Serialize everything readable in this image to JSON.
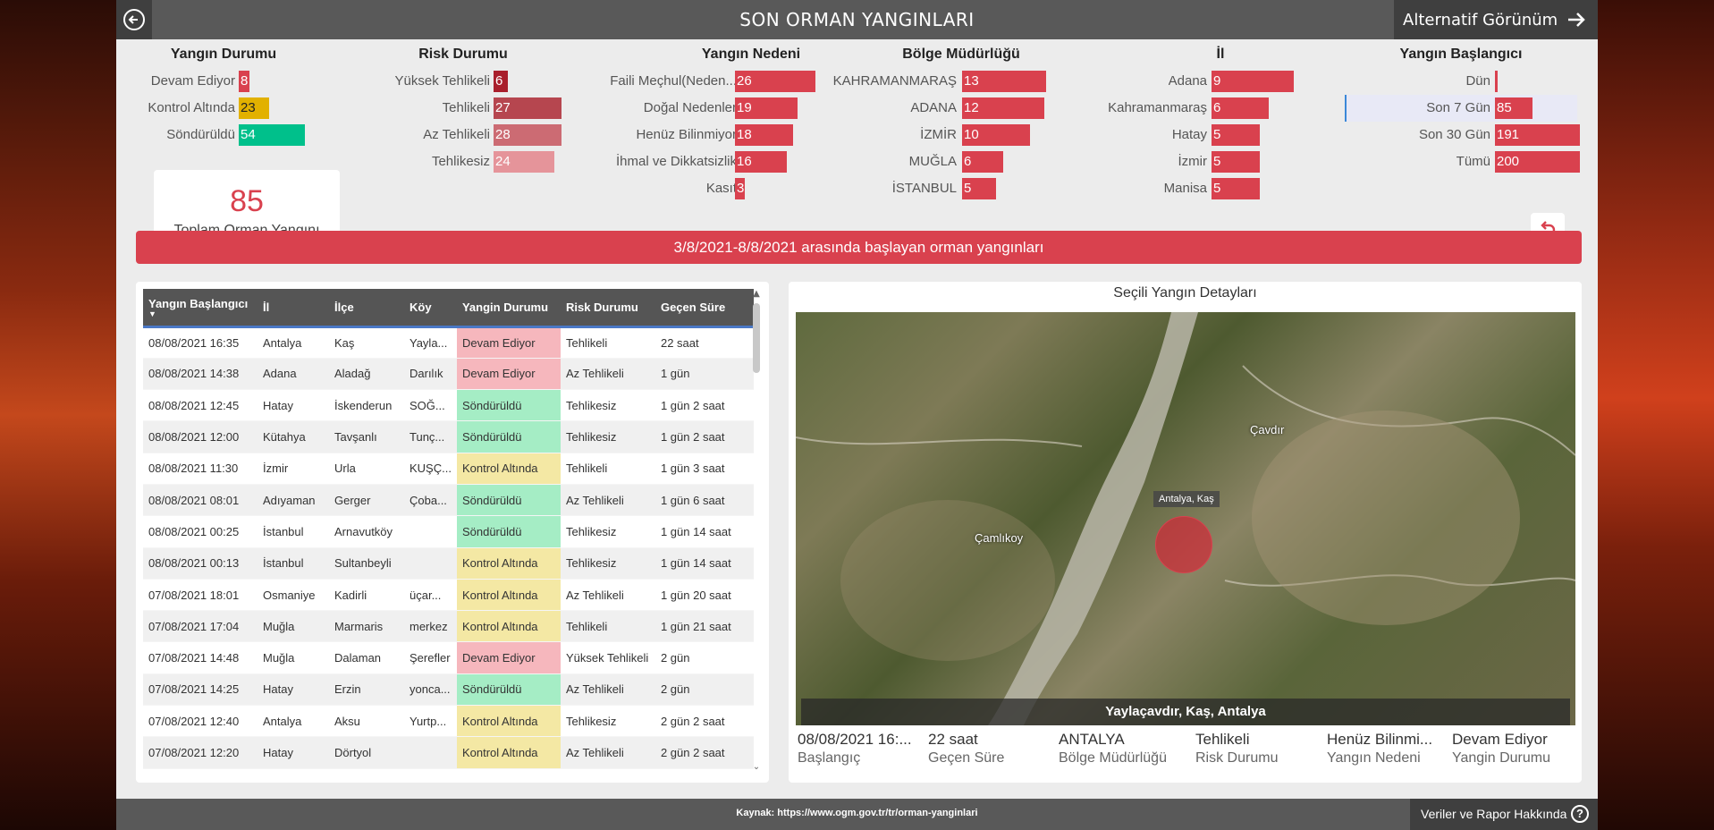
{
  "header": {
    "title": "SON ORMAN YANGINLARI",
    "alt_view": "Alternatif Görünüm"
  },
  "colors": {
    "accent": "#d9414e",
    "yellow": "#e2b100",
    "green": "#00c08b",
    "dark_header": "#595959"
  },
  "filters": {
    "yangin_durumu": {
      "title": "Yangın Durumu",
      "items": [
        {
          "label": "Devam Ediyor",
          "value": "8"
        },
        {
          "label": "Kontrol Altında",
          "value": "23"
        },
        {
          "label": "Söndürüldü",
          "value": "54"
        }
      ]
    },
    "risk_durumu": {
      "title": "Risk Durumu",
      "items": [
        {
          "label": "Yüksek Tehlikeli",
          "value": "6"
        },
        {
          "label": "Tehlikeli",
          "value": "27"
        },
        {
          "label": "Az Tehlikeli",
          "value": "28"
        },
        {
          "label": "Tehlikesiz",
          "value": "24"
        }
      ]
    },
    "yangin_nedeni": {
      "title": "Yangın Nedeni",
      "items": [
        {
          "label": "Faili Meçhul(Neden...",
          "value": "26"
        },
        {
          "label": "Doğal Nedenler",
          "value": "19"
        },
        {
          "label": "Henüz Bilinmiyor",
          "value": "18"
        },
        {
          "label": "İhmal ve Dikkatsizlik",
          "value": "16"
        },
        {
          "label": "Kasıt",
          "value": "3"
        }
      ]
    },
    "bolge": {
      "title": "Bölge Müdürlüğü",
      "items": [
        {
          "label": "KAHRAMANMARAŞ",
          "value": "13"
        },
        {
          "label": "ADANA",
          "value": "12"
        },
        {
          "label": "İZMİR",
          "value": "10"
        },
        {
          "label": "MUĞLA",
          "value": "6"
        },
        {
          "label": "İSTANBUL",
          "value": "5"
        }
      ]
    },
    "il": {
      "title": "İl",
      "items": [
        {
          "label": "Adana",
          "value": "9"
        },
        {
          "label": "Kahramanmaraş",
          "value": "6"
        },
        {
          "label": "Hatay",
          "value": "5"
        },
        {
          "label": "İzmir",
          "value": "5"
        },
        {
          "label": "Manisa",
          "value": "5"
        }
      ]
    },
    "baslangic": {
      "title": "Yangın Başlangıcı",
      "items": [
        {
          "label": "Dün",
          "value": ""
        },
        {
          "label": "Son 7 Gün",
          "value": "85"
        },
        {
          "label": "Son 30 Gün",
          "value": "191"
        },
        {
          "label": "Tümü",
          "value": "200"
        }
      ]
    }
  },
  "total": {
    "value": "85",
    "label": "Toplam Orman Yangını"
  },
  "banner": "3/8/2021-8/8/2021 arasında başlayan orman yangınları",
  "table": {
    "headers": [
      "Yangın Başlangıcı",
      "İl",
      "İlçe",
      "Köy",
      "Yangin Durumu",
      "Risk Durumu",
      "Geçen Süre"
    ],
    "rows": [
      [
        "08/08/2021 16:35",
        "Antalya",
        "Kaş",
        "Yayla...",
        "Devam Ediyor",
        "Tehlikeli",
        " 22 saat"
      ],
      [
        "08/08/2021 14:38",
        "Adana",
        "Aladağ",
        "Darılık",
        "Devam Ediyor",
        "Az Tehlikeli",
        "1 gün"
      ],
      [
        "08/08/2021 12:45",
        "Hatay",
        "İskenderun",
        "SOĞ...",
        "Söndürüldü",
        "Tehlikesiz",
        "1 gün 2 saat"
      ],
      [
        "08/08/2021 12:00",
        "Kütahya",
        "Tavşanlı",
        "Tunç...",
        "Söndürüldü",
        "Tehlikesiz",
        "1 gün 2 saat"
      ],
      [
        "08/08/2021 11:30",
        "İzmir",
        "Urla",
        "KUŞÇ...",
        "Kontrol Altında",
        "Tehlikeli",
        "1 gün 3 saat"
      ],
      [
        "08/08/2021 08:01",
        "Adıyaman",
        "Gerger",
        "Çoba...",
        "Söndürüldü",
        "Az Tehlikeli",
        "1 gün 6 saat"
      ],
      [
        "08/08/2021 00:25",
        "İstanbul",
        "Arnavutköy",
        "",
        "Söndürüldü",
        "Tehlikesiz",
        "1 gün 14 saat"
      ],
      [
        "08/08/2021 00:13",
        "İstanbul",
        "Sultanbeyli",
        "",
        "Kontrol Altında",
        "Tehlikesiz",
        "1 gün 14 saat"
      ],
      [
        "07/08/2021 18:01",
        "Osmaniye",
        "Kadirli",
        "üçar...",
        "Kontrol Altında",
        "Az Tehlikeli",
        "1 gün 20 saat"
      ],
      [
        "07/08/2021 17:04",
        "Muğla",
        "Marmaris",
        "merkez",
        "Kontrol Altında",
        "Tehlikeli",
        "1 gün 21 saat"
      ],
      [
        "07/08/2021 14:48",
        "Muğla",
        "Dalaman",
        "Şerefler",
        "Devam Ediyor",
        "Yüksek Tehlikeli",
        "2 gün"
      ],
      [
        "07/08/2021 14:25",
        "Hatay",
        "Erzin",
        "yonca...",
        "Söndürüldü",
        "Az Tehlikeli",
        "2 gün"
      ],
      [
        "07/08/2021 12:40",
        "Antalya",
        "Aksu",
        "Yurtp...",
        "Kontrol Altında",
        "Tehlikesiz",
        "2 gün 2 saat"
      ],
      [
        "07/08/2021 12:20",
        "Hatay",
        "Dörtyol",
        "",
        "Kontrol Altında",
        "Az Tehlikeli",
        "2 gün 2 saat"
      ]
    ]
  },
  "detail": {
    "title": "Seçili Yangın Detayları",
    "map_places": [
      "Çavdır",
      "Çamlıkoy"
    ],
    "pin_label": "Antalya, Kaş",
    "caption": "Yaylaçavdır, Kaş, Antalya",
    "cards": [
      {
        "value": "08/08/2021 16:...",
        "key": "Başlangıç"
      },
      {
        "value": "22 saat",
        "key": "Geçen Süre"
      },
      {
        "value": "ANTALYA",
        "key": "Bölge Müdürlüğü"
      },
      {
        "value": "Tehlikeli",
        "key": "Risk Durumu"
      },
      {
        "value": "Henüz Bilinmi...",
        "key": "Yangın Nedeni"
      },
      {
        "value": "Devam Ediyor",
        "key": "Yangin Durumu"
      }
    ]
  },
  "footer": {
    "source": "Kaynak: https://www.ogm.gov.tr/tr/orman-yanginlari",
    "about": "Veriler ve Rapor Hakkında",
    "help_icon": "?"
  }
}
